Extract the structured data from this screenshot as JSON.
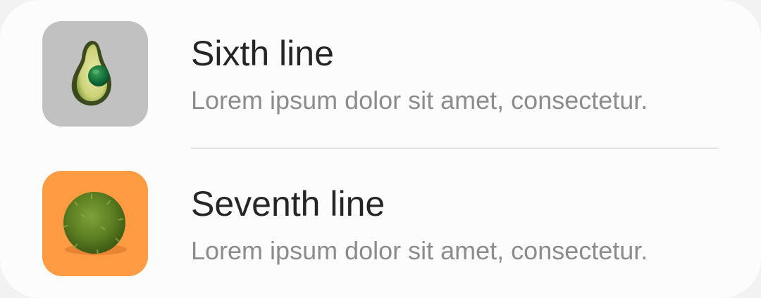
{
  "list": {
    "items": [
      {
        "title": "Sixth line",
        "subtitle": "Lorem ipsum dolor sit amet, consectetur.",
        "thumbnail": "avocado-image",
        "thumbnail_bg": "#c1c1c1"
      },
      {
        "title": "Seventh line",
        "subtitle": "Lorem ipsum dolor sit amet, consectetur.",
        "thumbnail": "green-moss-ball-image",
        "thumbnail_bg": "#ff9b43"
      }
    ]
  }
}
